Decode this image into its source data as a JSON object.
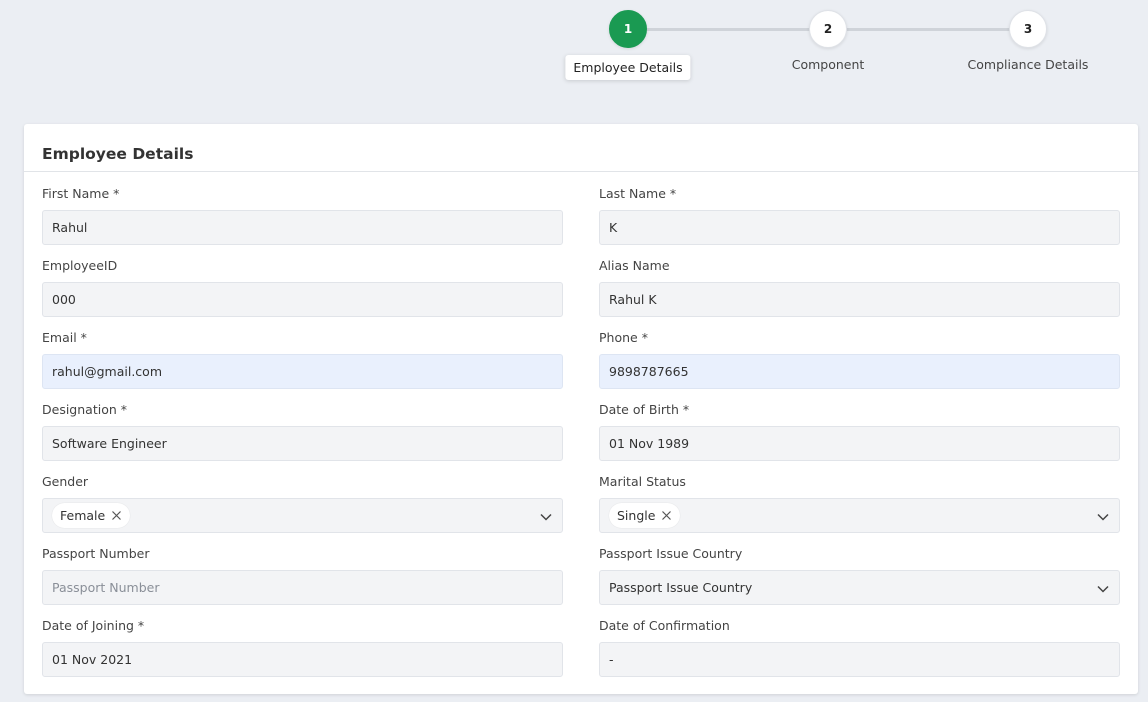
{
  "stepper": {
    "steps": [
      {
        "number": "1",
        "label": "Employee Details",
        "active": true
      },
      {
        "number": "2",
        "label": "Component",
        "active": false
      },
      {
        "number": "3",
        "label": "Compliance Details",
        "active": false
      }
    ]
  },
  "card": {
    "title": "Employee Details",
    "fields": {
      "first_name": {
        "label": "First Name *",
        "value": "Rahul"
      },
      "last_name": {
        "label": "Last Name *",
        "value": "K"
      },
      "employee_id": {
        "label": "EmployeeID",
        "value": "000"
      },
      "alias_name": {
        "label": "Alias Name",
        "value": "Rahul K"
      },
      "email": {
        "label": "Email *",
        "value": "rahul@gmail.com"
      },
      "phone": {
        "label": "Phone *",
        "value": "9898787665"
      },
      "designation": {
        "label": "Designation *",
        "value": "Software Engineer"
      },
      "dob": {
        "label": "Date of Birth *",
        "value": "01 Nov 1989"
      },
      "gender": {
        "label": "Gender",
        "value": "Female"
      },
      "marital_status": {
        "label": "Marital Status",
        "value": "Single"
      },
      "passport_number": {
        "label": "Passport Number",
        "placeholder": "Passport Number"
      },
      "passport_country": {
        "label": "Passport Issue Country",
        "placeholder": "Passport Issue Country"
      },
      "doj": {
        "label": "Date of Joining *",
        "value": "01 Nov 2021"
      },
      "doc": {
        "label": "Date of Confirmation",
        "value": "-"
      }
    }
  },
  "colors": {
    "active_step": "#1a9a52",
    "focused_field": "#e9f0fd",
    "page_bg": "#ebeef3"
  }
}
